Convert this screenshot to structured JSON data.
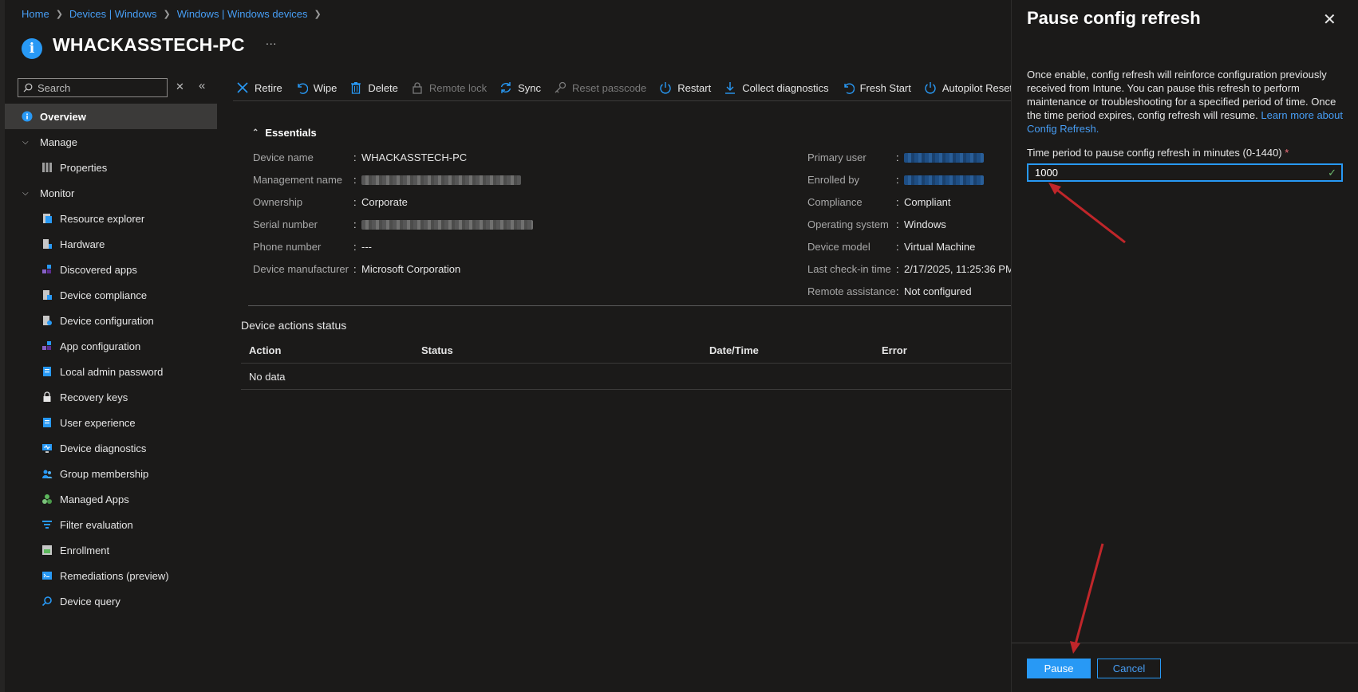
{
  "breadcrumb": [
    "Home",
    "Devices | Windows",
    "Windows | Windows devices"
  ],
  "page_title": "WHACKASSTECH-PC",
  "more_label": "···",
  "search": {
    "placeholder": "Search"
  },
  "sidebar": {
    "overview": "Overview",
    "manage": {
      "label": "Manage",
      "items": [
        "Properties"
      ]
    },
    "monitor": {
      "label": "Monitor",
      "items": [
        "Resource explorer",
        "Hardware",
        "Discovered apps",
        "Device compliance",
        "Device configuration",
        "App configuration",
        "Local admin password",
        "Recovery keys",
        "User experience",
        "Device diagnostics",
        "Group membership",
        "Managed Apps",
        "Filter evaluation",
        "Enrollment",
        "Remediations (preview)",
        "Device query"
      ]
    }
  },
  "toolbar": {
    "retire": "Retire",
    "wipe": "Wipe",
    "delete": "Delete",
    "remote_lock": "Remote lock",
    "sync": "Sync",
    "reset_passcode": "Reset passcode",
    "restart": "Restart",
    "collect_diagnostics": "Collect diagnostics",
    "fresh_start": "Fresh Start",
    "autopilot_reset": "Autopilot Reset"
  },
  "essentials": {
    "title": "Essentials",
    "left": [
      {
        "label": "Device name",
        "value": "WHACKASSTECH-PC"
      },
      {
        "label": "Management name",
        "value": ""
      },
      {
        "label": "Ownership",
        "value": "Corporate"
      },
      {
        "label": "Serial number",
        "value": ""
      },
      {
        "label": "Phone number",
        "value": "---"
      },
      {
        "label": "Device manufacturer",
        "value": "Microsoft Corporation"
      }
    ],
    "right": [
      {
        "label": "Primary user",
        "value": ""
      },
      {
        "label": "Enrolled by",
        "value": ""
      },
      {
        "label": "Compliance",
        "value": "Compliant"
      },
      {
        "label": "Operating system",
        "value": "Windows"
      },
      {
        "label": "Device model",
        "value": "Virtual Machine"
      },
      {
        "label": "Last check-in time",
        "value": "2/17/2025, 11:25:36 PM"
      },
      {
        "label": "Remote assistance",
        "value": "Not configured"
      }
    ]
  },
  "actions_status": {
    "title": "Device actions status",
    "columns": [
      "Action",
      "Status",
      "Date/Time",
      "Error"
    ],
    "empty": "No data"
  },
  "panel": {
    "title": "Pause config refresh",
    "description": "Once enable, config refresh will reinforce configuration previously received from Intune. You can pause this refresh to perform maintenance or troubleshooting for a specified period of time. Once the time period expires, config refresh will resume.",
    "learn_more": "Learn more about Config Refresh.",
    "field_label": "Time period to pause config refresh in minutes (0-1440)",
    "required_mark": "*",
    "field_value": "1000",
    "pause_label": "Pause",
    "cancel_label": "Cancel"
  },
  "colors": {
    "accent": "#2899f5",
    "background": "#1b1a19",
    "annotation_arrow": "#c0262a"
  }
}
